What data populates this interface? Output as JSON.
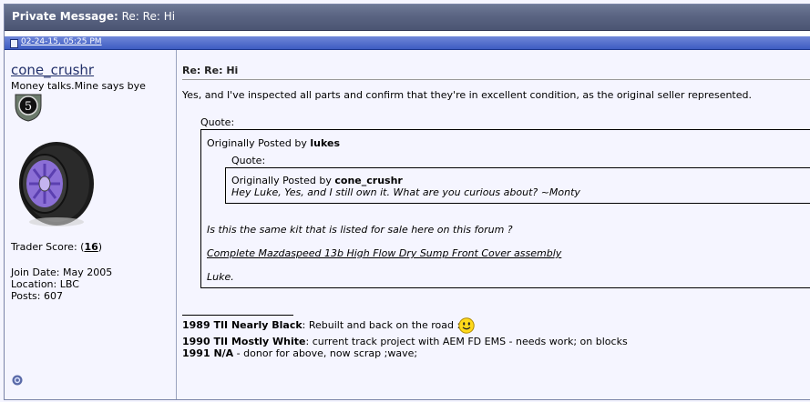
{
  "window": {
    "title_prefix": "Private Message:",
    "title_subject": "Re: Re: Hi"
  },
  "post": {
    "date": "02-24-15, 05:25 PM"
  },
  "user": {
    "name": "cone_crushr",
    "title": "Money talks.Mine says bye",
    "badge_number": "5",
    "trader_label": "Trader Score: (",
    "trader_score": "16",
    "trader_close": ")",
    "join": "Join Date: May 2005",
    "location": "Location: LBC",
    "posts": "Posts: 607"
  },
  "message": {
    "subject": "Re: Re: Hi",
    "body": "Yes, and I've inspected all parts and confirm that they're in excellent condition, as the original seller represented.",
    "quote_label": "Quote:",
    "outer_quote": {
      "prefix": "Originally Posted by",
      "author": "lukes",
      "inner_label": "Quote:",
      "inner_prefix": "Originally Posted by",
      "inner_author": "cone_crushr",
      "inner_text": "Hey Luke, Yes, and I still own it. What are you curious about? ~Monty",
      "question": "Is this the same kit that is listed for sale here on this forum ?",
      "link": "Complete Mazdaspeed 13b High Flow Dry Sump Front Cover assembly",
      "sign": "Luke."
    }
  },
  "signature": {
    "line1_bold": "1989 TII Nearly Black",
    "line1_rest": ": Rebuilt and back on the road :",
    "line2_bold": "1990 TII Mostly White",
    "line2_rest": ": current track project with AEM FD EMS - needs work; on blocks",
    "line3_bold": "1991 N/A",
    "line3_rest": " - donor for above, now scrap ;wave;"
  },
  "colors": {
    "title_bar": "#5a6482",
    "date_bar": "#4e6ccc",
    "background": "#f5f5ff"
  }
}
